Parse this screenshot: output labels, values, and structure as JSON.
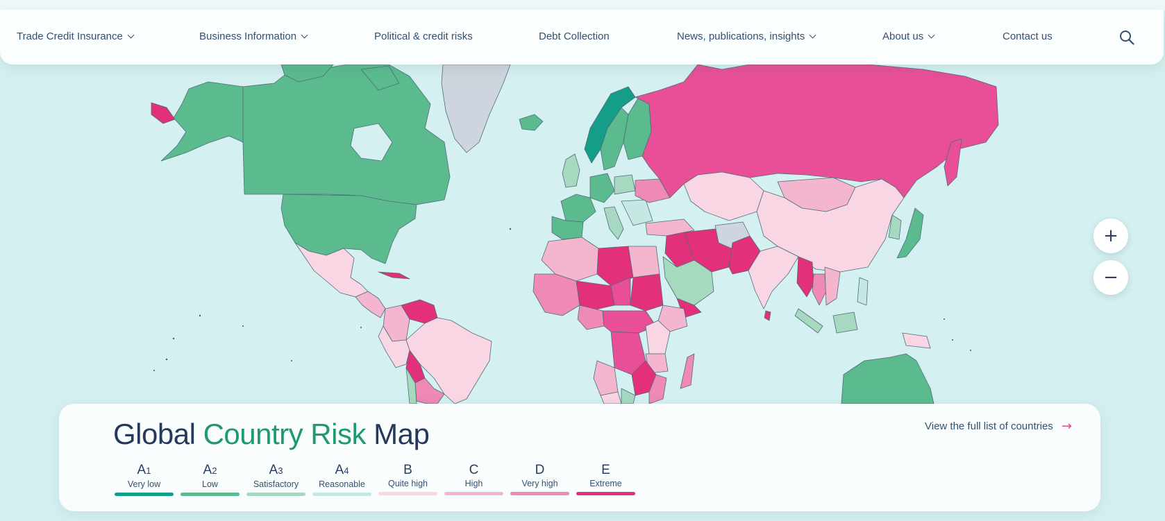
{
  "nav": {
    "items": [
      {
        "label": "Trade Credit Insurance",
        "dropdown": true
      },
      {
        "label": "Business Information",
        "dropdown": true
      },
      {
        "label": "Political & credit risks",
        "dropdown": false
      },
      {
        "label": "Debt Collection",
        "dropdown": false
      },
      {
        "label": "News, publications, insights",
        "dropdown": true
      },
      {
        "label": "About us",
        "dropdown": true
      },
      {
        "label": "Contact us",
        "dropdown": false
      }
    ],
    "search_icon": "search-icon"
  },
  "zoom": {
    "in_label": "+",
    "out_label": "−"
  },
  "legend": {
    "title_part1": "Global",
    "title_part2": "Country Risk",
    "title_part3": "Map",
    "view_all": "View the full list of countries",
    "arrow": "→",
    "grades": [
      {
        "letter": "A",
        "num": "1",
        "label": "Very low",
        "color": "#149e8a"
      },
      {
        "letter": "A",
        "num": "2",
        "label": "Low",
        "color": "#5bbb8f"
      },
      {
        "letter": "A",
        "num": "3",
        "label": "Satisfactory",
        "color": "#a7d9c0"
      },
      {
        "letter": "A",
        "num": "4",
        "label": "Reasonable",
        "color": "#c6e8e3"
      },
      {
        "letter": "B",
        "num": "",
        "label": "Quite high",
        "color": "#f9d6e4"
      },
      {
        "letter": "C",
        "num": "",
        "label": "High",
        "color": "#f4b6ce"
      },
      {
        "letter": "D",
        "num": "",
        "label": "Very high",
        "color": "#ee8ab5"
      },
      {
        "letter": "E",
        "num": "",
        "label": "Extreme",
        "color": "#e3307b"
      }
    ]
  },
  "colors": {
    "background": "#d5f0f0",
    "ocean": "#d5f0f0",
    "no_rating": "#cfd5de",
    "border": "#3d5a66"
  }
}
